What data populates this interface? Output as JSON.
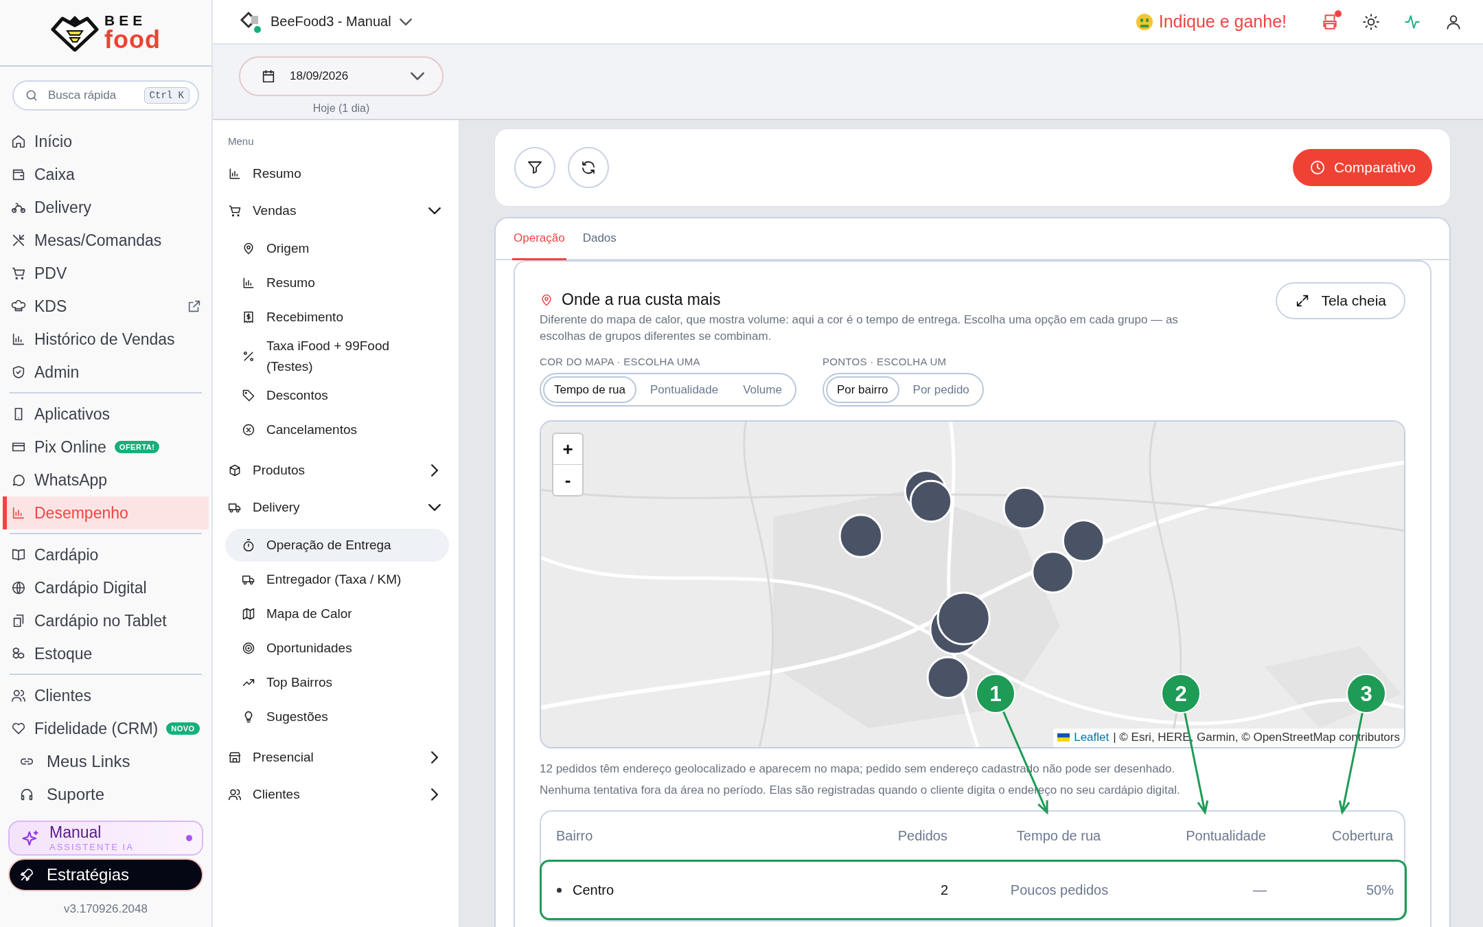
{
  "brand": {
    "line1": "BEE",
    "line2": "food"
  },
  "search": {
    "placeholder": "Busca rápida",
    "shortcut": "Ctrl K"
  },
  "nav_groups": [
    [
      {
        "label": "Início",
        "selected": false
      },
      {
        "label": "Caixa",
        "selected": false
      },
      {
        "label": "Delivery",
        "selected": false
      },
      {
        "label": "Mesas/Comandas",
        "selected": false
      },
      {
        "label": "PDV",
        "selected": false
      },
      {
        "label": "KDS",
        "selected": false,
        "external": true
      },
      {
        "label": "Histórico de Vendas",
        "selected": false
      },
      {
        "label": "Admin",
        "selected": false
      }
    ],
    [
      {
        "label": "Aplicativos",
        "selected": false
      },
      {
        "label": "Pix Online",
        "selected": false,
        "badge": "OFERTA!"
      },
      {
        "label": "WhatsApp",
        "selected": false
      },
      {
        "label": "Desempenho",
        "selected": true
      }
    ],
    [
      {
        "label": "Cardápio",
        "selected": false
      },
      {
        "label": "Cardápio Digital",
        "selected": false
      },
      {
        "label": "Cardápio no Tablet",
        "selected": false
      },
      {
        "label": "Estoque",
        "selected": false
      }
    ],
    [
      {
        "label": "Clientes",
        "selected": false
      },
      {
        "label": "Fidelidade (CRM)",
        "selected": false,
        "badge": "NOVO"
      }
    ]
  ],
  "footer_links": [
    {
      "label": "Meus Links"
    },
    {
      "label": "Suporte"
    }
  ],
  "assistant": {
    "title": "Manual",
    "subtitle": "ASSISTENTE IA",
    "unread": true
  },
  "strategies_button": "Estratégias",
  "version": "v3.170926.2048",
  "topbar": {
    "workspace": "BeeFood3 - Manual",
    "online": true,
    "referral": "Indique e ganhe!",
    "printer_alert": true
  },
  "date_picker": {
    "value": "18/09/2026",
    "caption": "Hoje (1 dia)"
  },
  "menu": {
    "heading": "Menu",
    "items": [
      {
        "label": "Resumo"
      },
      {
        "label": "Vendas",
        "expanded": true,
        "children": [
          {
            "label": "Origem",
            "selected": false
          },
          {
            "label": "Resumo",
            "selected": false
          },
          {
            "label": "Recebimento",
            "selected": false
          },
          {
            "label": "Taxa iFood + 99Food (Testes)",
            "selected": false
          },
          {
            "label": "Descontos",
            "selected": false
          },
          {
            "label": "Cancelamentos",
            "selected": false
          }
        ]
      },
      {
        "label": "Produtos",
        "expanded": false
      },
      {
        "label": "Delivery",
        "expanded": true,
        "children": [
          {
            "label": "Operação de Entrega",
            "selected": true
          },
          {
            "label": "Entregador (Taxa / KM)",
            "selected": false
          },
          {
            "label": "Mapa de Calor",
            "selected": false
          },
          {
            "label": "Oportunidades",
            "selected": false
          },
          {
            "label": "Top Bairros",
            "selected": false
          },
          {
            "label": "Sugestões",
            "selected": false
          }
        ]
      },
      {
        "label": "Presencial",
        "expanded": false
      },
      {
        "label": "Clientes",
        "expanded": false
      }
    ]
  },
  "toolbar": {
    "compare_button": "Comparativo"
  },
  "tabs": [
    {
      "label": "Operação",
      "selected": true
    },
    {
      "label": "Dados",
      "selected": false
    }
  ],
  "section": {
    "title": "Onde a rua custa mais",
    "description": "Diferente do mapa de calor, que mostra volume: aqui a cor é o tempo de entrega. Escolha uma opção em cada grupo — as escolhas de grupos diferentes se combinam.",
    "fullscreen_button": "Tela cheia",
    "groups": [
      {
        "label": "COR DO MAPA · ESCOLHA UMA",
        "options": [
          {
            "label": "Tempo de rua",
            "selected": true
          },
          {
            "label": "Pontualidade",
            "selected": false
          },
          {
            "label": "Volume",
            "selected": false
          }
        ]
      },
      {
        "label": "PONTOS · ESCOLHA UM",
        "options": [
          {
            "label": "Por bairro",
            "selected": true
          },
          {
            "label": "Por pedido",
            "selected": false
          }
        ]
      }
    ],
    "map": {
      "zoom_in": "+",
      "zoom_out": "-",
      "attribution_link": "Leaflet",
      "attribution": "| © Esri, HERE, Garmin, © OpenStreetMap contributors"
    },
    "notes": [
      "12 pedidos têm endereço geolocalizado e aparecem no mapa; pedido sem endereço cadastrado não pode ser desenhado.",
      "Nenhuma tentativa fora da área no período. Elas são registradas quando o cliente digita o endereço no seu cardápio digital."
    ],
    "table": {
      "columns": [
        "Bairro",
        "Pedidos",
        "Tempo de rua",
        "Pontualidade",
        "Cobertura"
      ],
      "rows": [
        {
          "cells": [
            "Centro",
            "2",
            "Poucos pedidos",
            "—",
            "50%"
          ],
          "highlighted": true
        }
      ]
    }
  },
  "annotations": [
    {
      "number": "1"
    },
    {
      "number": "2"
    },
    {
      "number": "3"
    }
  ]
}
